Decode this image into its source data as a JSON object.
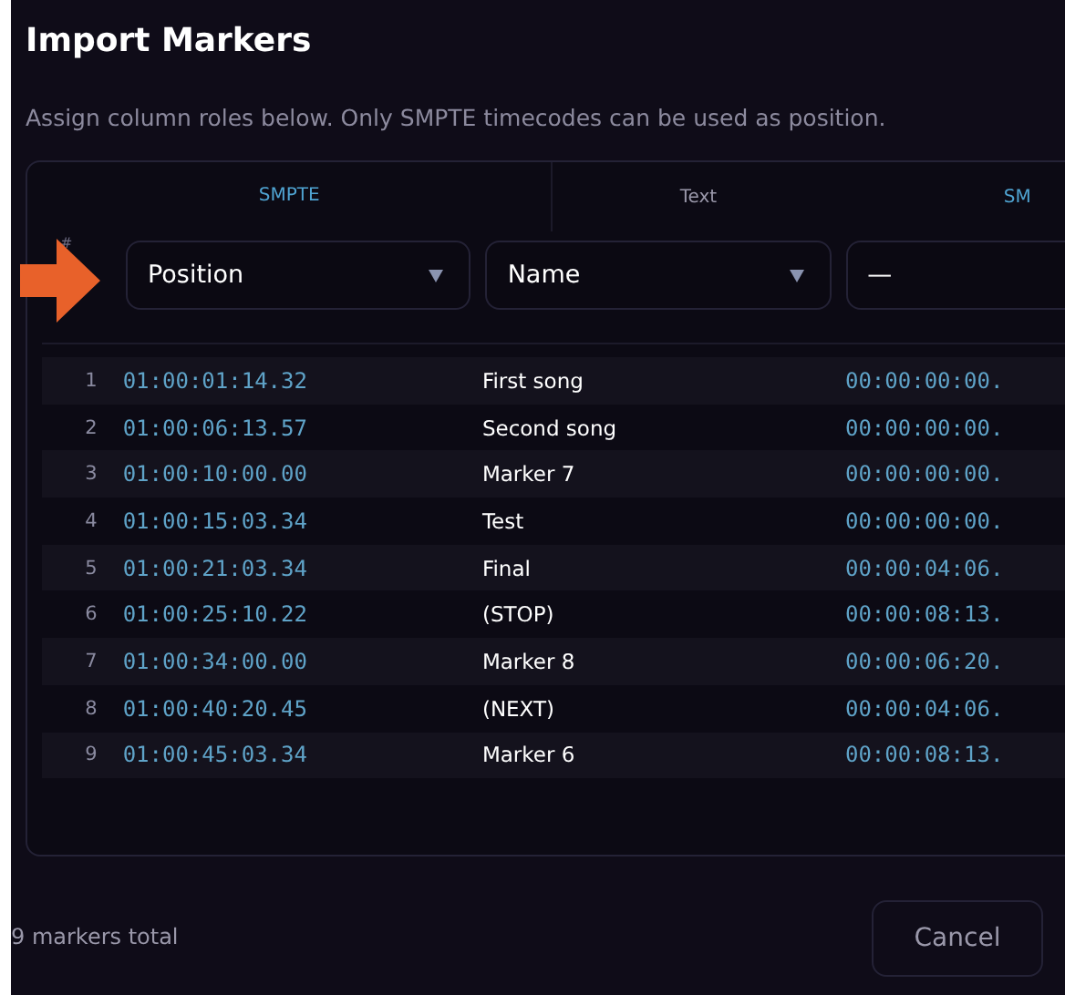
{
  "title": "Import Markers",
  "subtitle": "Assign column roles below. Only SMPTE timecodes can be used as position.",
  "columns": [
    {
      "type_label": "SMPTE",
      "kind": "smpte",
      "role": "Position"
    },
    {
      "type_label": "Text",
      "kind": "text",
      "role": "Name"
    },
    {
      "type_label": "SM",
      "kind": "smpte",
      "role": "—"
    }
  ],
  "index_header": "#",
  "rows": [
    {
      "index": "1",
      "cells": [
        "01:00:01:14.32",
        "First song",
        "00:00:00:00."
      ]
    },
    {
      "index": "2",
      "cells": [
        "01:00:06:13.57",
        "Second song",
        "00:00:00:00."
      ]
    },
    {
      "index": "3",
      "cells": [
        "01:00:10:00.00",
        "Marker 7",
        "00:00:00:00."
      ]
    },
    {
      "index": "4",
      "cells": [
        "01:00:15:03.34",
        "Test",
        "00:00:00:00."
      ]
    },
    {
      "index": "5",
      "cells": [
        "01:00:21:03.34",
        "Final",
        "00:00:04:06."
      ]
    },
    {
      "index": "6",
      "cells": [
        "01:00:25:10.22",
        "(STOP)",
        "00:00:08:13."
      ]
    },
    {
      "index": "7",
      "cells": [
        "01:00:34:00.00",
        "Marker 8",
        "00:00:06:20."
      ]
    },
    {
      "index": "8",
      "cells": [
        "01:00:40:20.45",
        "(NEXT)",
        "00:00:04:06."
      ]
    },
    {
      "index": "9",
      "cells": [
        "01:00:45:03.34",
        "Marker 6",
        "00:00:08:13."
      ]
    }
  ],
  "footer": {
    "count": "9 markers total",
    "cancel": "Cancel"
  }
}
